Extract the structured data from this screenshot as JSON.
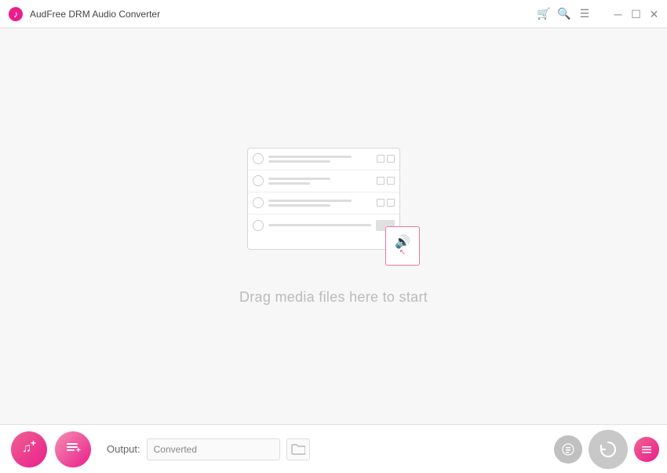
{
  "titleBar": {
    "appTitle": "AudFree DRM Audio Converter",
    "icons": {
      "cart": "🛒",
      "search": "🔍",
      "menu": "☰"
    },
    "windowControls": {
      "minimize": "─",
      "maximize": "☐",
      "close": "✕"
    }
  },
  "mainArea": {
    "dragText": "Drag media files here to start"
  },
  "bottomToolbar": {
    "addMusicLabel": "♫",
    "addPlaylistLabel": "≡",
    "outputLabel": "Output:",
    "outputValue": "Converted",
    "folderIcon": "📁",
    "historyIcon": "⊙",
    "convertIcon": "↻",
    "settingsIcon": "☰"
  }
}
